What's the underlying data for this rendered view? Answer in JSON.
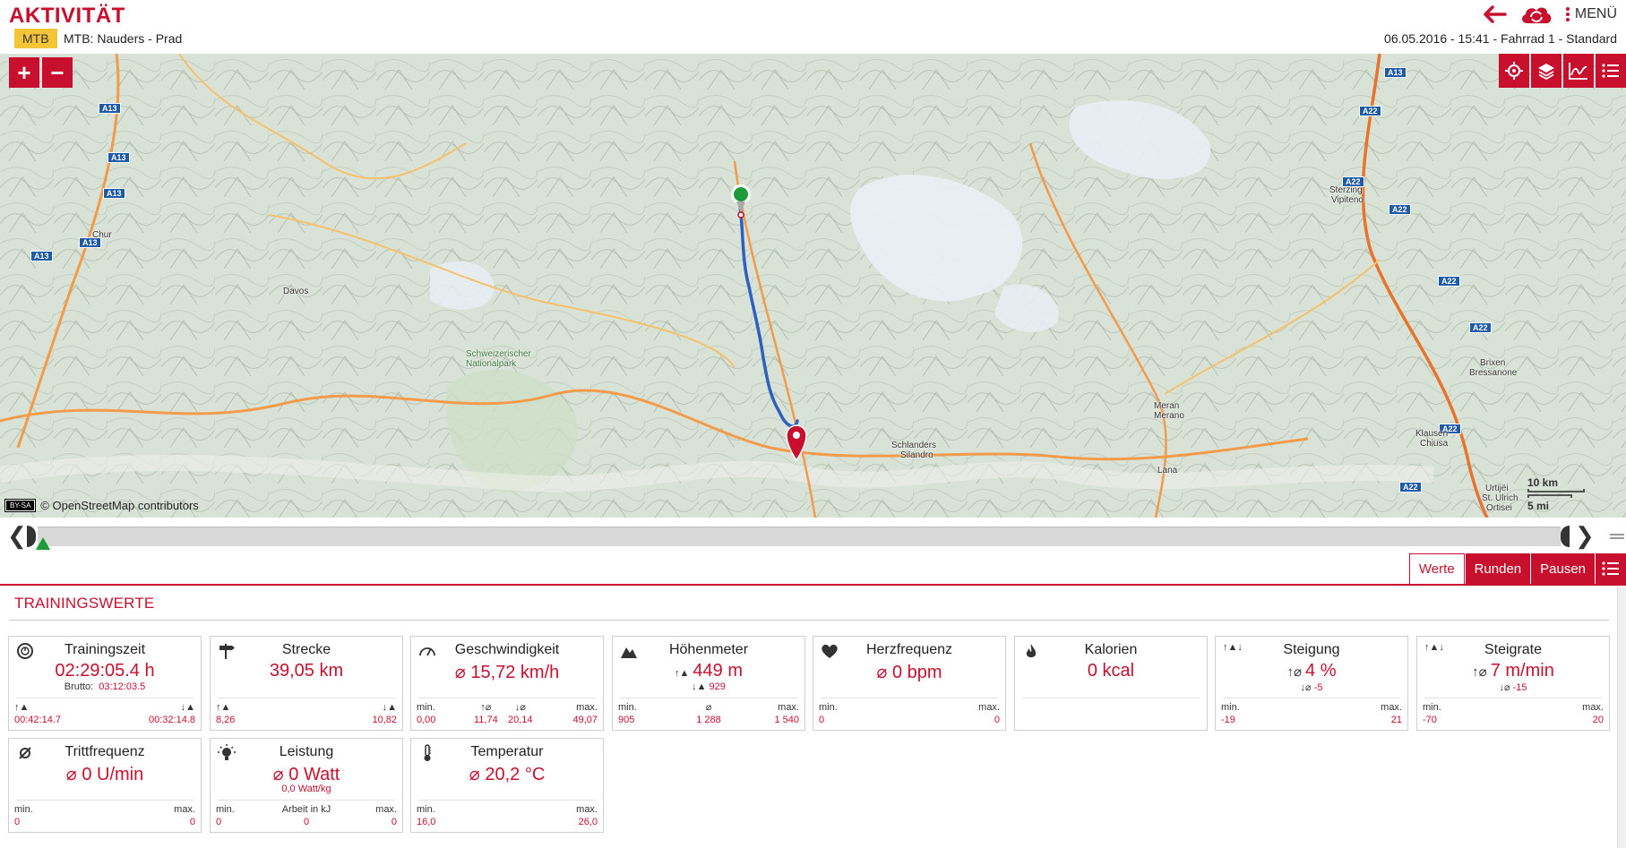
{
  "header": {
    "title": "AKTIVITÄT",
    "sport_badge": "MTB",
    "activity_name": "MTB: Nauders - Prad",
    "menu_label": "MENÜ",
    "info": "06.05.2016  -  15:41  -  Fahrrad 1  -  Standard",
    "accent_color": "#c8102e"
  },
  "map": {
    "zoom_in": "+",
    "zoom_out": "−",
    "attribution": "© OpenStreetMap contributors",
    "license": "BY-SA",
    "scale_km": "10 km",
    "scale_mi": "5 mi",
    "places": [
      "Chur",
      "Davos",
      "Schlanders",
      "Silandro",
      "Meran",
      "Merano",
      "Lana",
      "Sterzing",
      "Vipiteno",
      "Brixen",
      "Bressanone",
      "Klausen",
      "Chiusa",
      "Urtijëi",
      "St. Ulrich",
      "Ortisei",
      "Schweizerischer Nationalpark"
    ],
    "highways": [
      "A13",
      "A22"
    ],
    "tools": [
      "locate-icon",
      "layers-icon",
      "chart-icon",
      "list-icon"
    ]
  },
  "tabs": {
    "werte": "Werte",
    "runden": "Runden",
    "pausen": "Pausen"
  },
  "section": {
    "title": "TRAININGSWERTE"
  },
  "cards": {
    "trainingszeit": {
      "label": "Trainingszeit",
      "main": "02:29:05.4 h",
      "sub_key": "Brutto:",
      "sub_val": "03:12:03.5",
      "up": "00:42:14.7",
      "down": "00:32:14.8"
    },
    "strecke": {
      "label": "Strecke",
      "main": "39,05 km",
      "up": "8,26",
      "down": "10,82"
    },
    "geschwindigkeit": {
      "label": "Geschwindigkeit",
      "main": "⌀ 15,72 km/h",
      "min_label": "min.",
      "min": "0,00",
      "up": "11,74",
      "down": "20,14",
      "max_label": "max.",
      "max": "49,07"
    },
    "hoehenmeter": {
      "label": "Höhenmeter",
      "main": "449 m",
      "sub": "929",
      "min_label": "min.",
      "min": "905",
      "avg": "1 288",
      "max_label": "max.",
      "max": "1 540"
    },
    "herzfrequenz": {
      "label": "Herzfrequenz",
      "main": "⌀ 0 bpm",
      "min_label": "min.",
      "min": "0",
      "max_label": "max.",
      "max": "0"
    },
    "kalorien": {
      "label": "Kalorien",
      "main": "0 kcal"
    },
    "steigung": {
      "label": "Steigung",
      "main": "4 %",
      "sub": "-5",
      "min_label": "min.",
      "min": "-19",
      "max_label": "max.",
      "max": "21"
    },
    "steigrate": {
      "label": "Steigrate",
      "main": "7 m/min",
      "sub": "-15",
      "min_label": "min.",
      "min": "-70",
      "max_label": "max.",
      "max": "20"
    },
    "trittfrequenz": {
      "label": "Trittfrequenz",
      "main": "⌀ 0 U/min",
      "min_label": "min.",
      "min": "0",
      "max_label": "max.",
      "max": "0"
    },
    "leistung": {
      "label": "Leistung",
      "main": "⌀ 0 Watt",
      "sub": "0,0 Watt/kg",
      "min_label": "min.",
      "min": "0",
      "mid_label": "Arbeit in kJ",
      "mid": "0",
      "max_label": "max.",
      "max": "0"
    },
    "temperatur": {
      "label": "Temperatur",
      "main": "⌀ 20,2 °C",
      "min_label": "min.",
      "min": "16,0",
      "max_label": "max.",
      "max": "26,0"
    }
  }
}
